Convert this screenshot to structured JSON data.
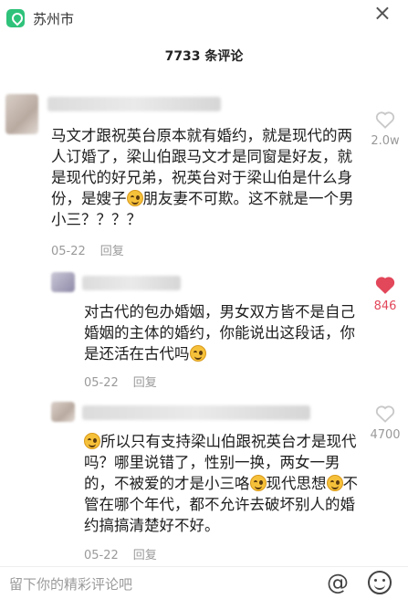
{
  "header": {
    "location": "苏州市",
    "close_glyph": "×"
  },
  "comments_title": "7733 条评论",
  "comments": [
    {
      "text_segments": [
        "马文才跟祝英台原本就有婚约，就是现代的两人订婚了，梁山伯跟马文才是同窗是好友，就是现代的好兄弟，祝英台对于梁山伯是什么身份，是嫂子",
        "朋友妻不可欺。这不就是一个男小三？？？？"
      ],
      "date": "05-22",
      "reply_label": "回复",
      "likes": "2.0w",
      "liked": false
    },
    {
      "text_segments": [
        "对古代的包办婚姻，男女双方皆不是自己婚姻的主体的婚约，你能说出这段话，你是还活在古代吗"
      ],
      "date": "05-22",
      "reply_label": "回复",
      "likes": "846",
      "liked": true
    },
    {
      "text_segments": [
        "所以只有支持梁山伯跟祝英台才是现代吗？哪里说错了，性别一换，两女一男的，不被爱的才是小三咯",
        "现代思想",
        "不管在哪个年代，都不允许去破坏别人的婚约搞搞清楚好不好。"
      ],
      "date": "05-22",
      "reply_label": "回复",
      "likes": "4700",
      "liked": false
    }
  ],
  "input": {
    "placeholder": "留下你的精彩评论吧"
  },
  "icons": {
    "at": "@"
  },
  "colors": {
    "liked_heart": "#e2475a",
    "location_icon": "#2fc27a"
  }
}
